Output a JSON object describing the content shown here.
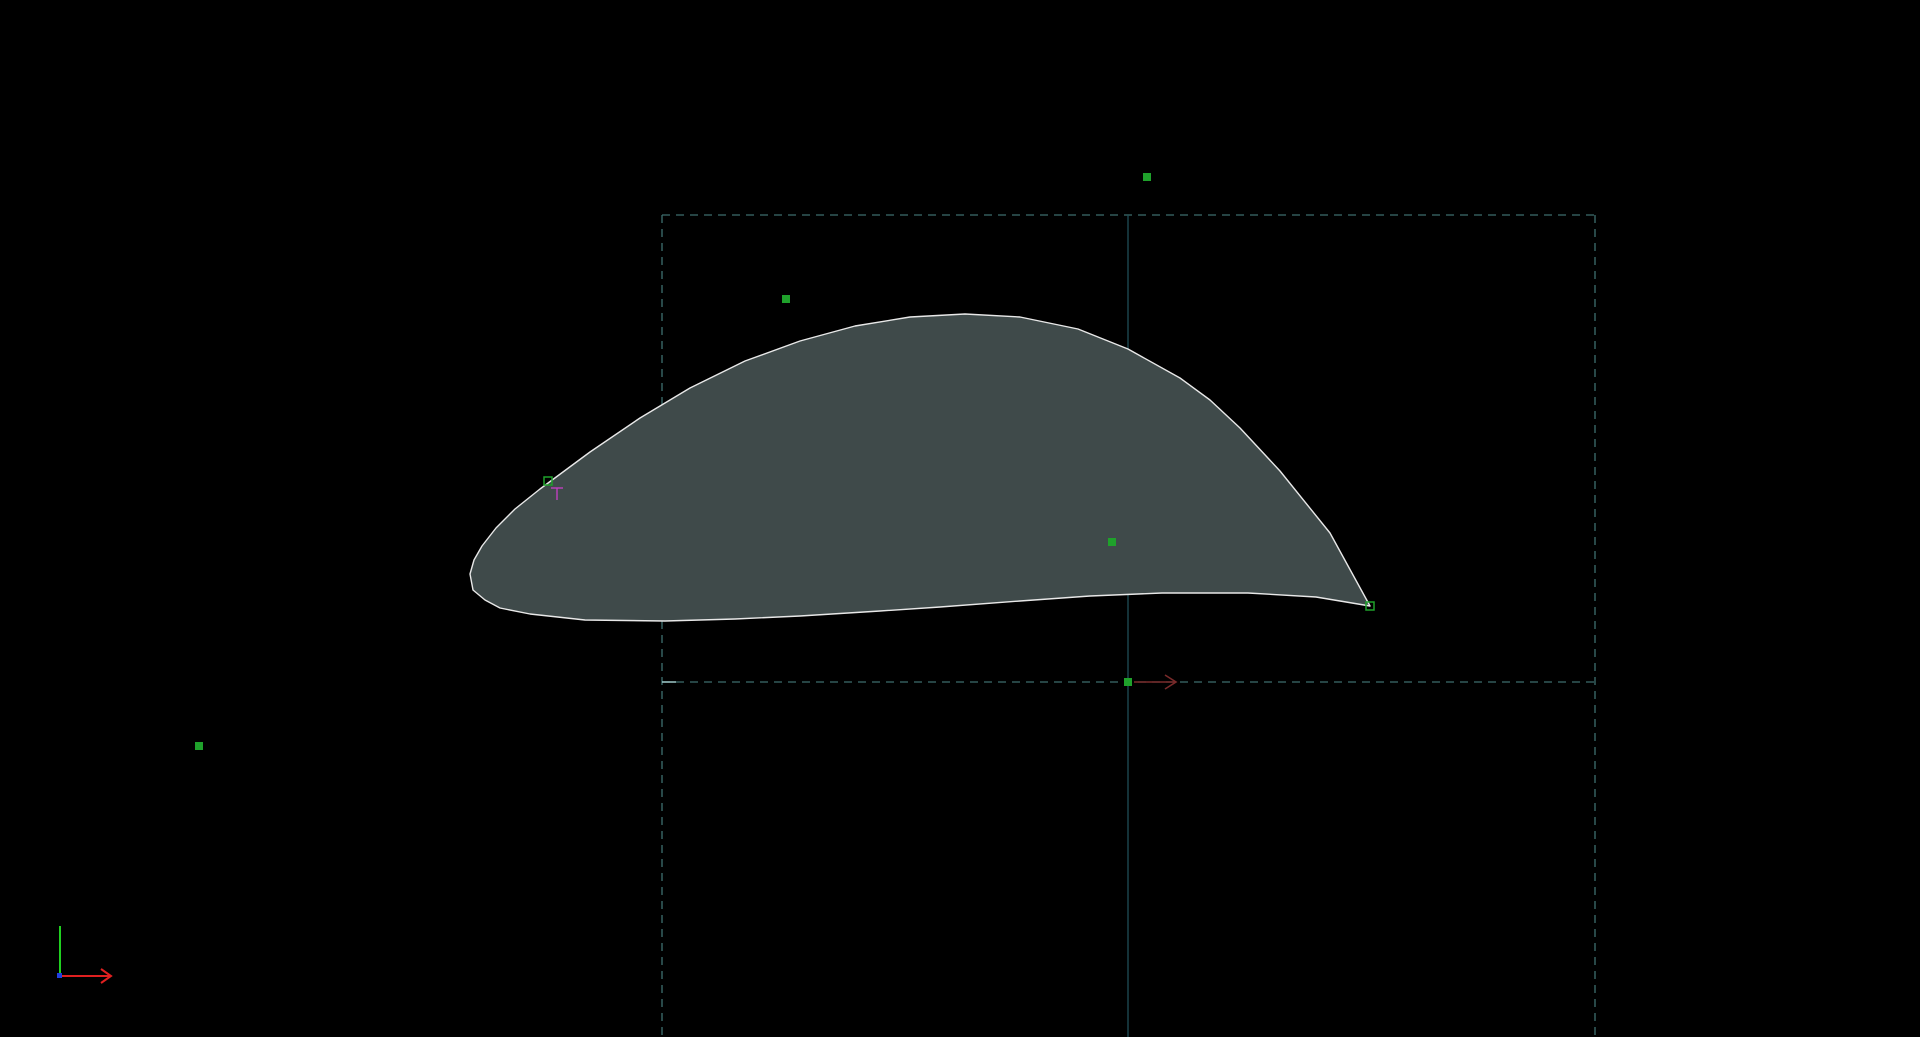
{
  "viewport": {
    "name": "cad-sketch-viewport",
    "background": "#000000"
  },
  "colors": {
    "profile_fill": "#3f4a4a",
    "profile_stroke": "#e8e8e8",
    "construction_line": "#3d6e6e",
    "control_point": "#1fa12b",
    "direction_arrow": "#7a2a2a",
    "constraint_marker": "#c040c0",
    "axis_x": "#e02020",
    "axis_y": "#20d020",
    "axis_z": "#2040e0"
  },
  "icons": {
    "origin_triad": "xyz-axes-icon",
    "direction_arrow": "arrow-right-icon",
    "constraint_marker": "tangent-constraint-icon"
  }
}
